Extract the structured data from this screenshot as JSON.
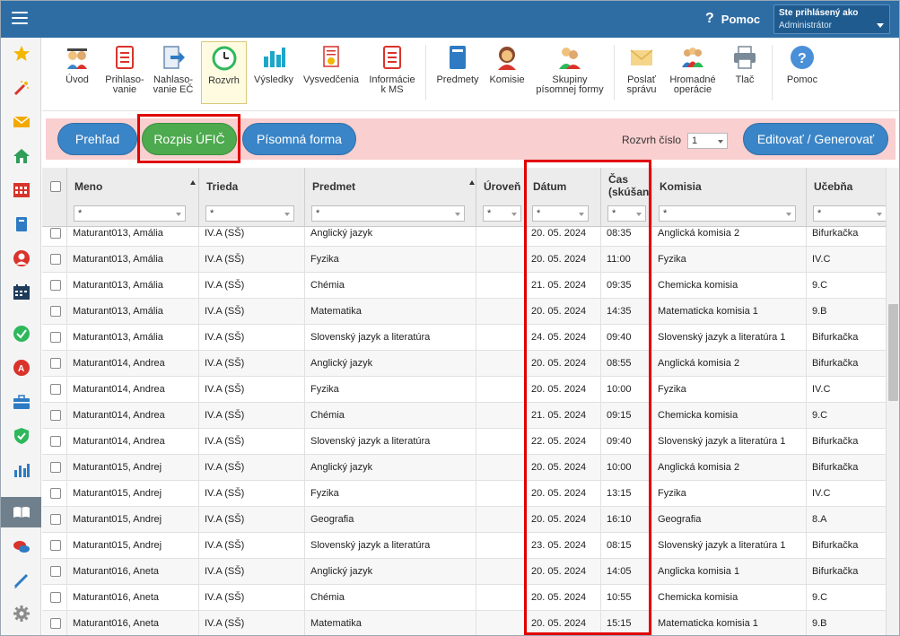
{
  "topbar": {
    "help_label": "Pomoc",
    "user_label": "Ste prihlásený ako",
    "user_role": "Administrátor"
  },
  "sidebar": {
    "icons": [
      "star-icon",
      "magic-wand-icon",
      "mail-icon",
      "home-icon",
      "calendar-grid-icon",
      "book-icon",
      "person-icon",
      "schedule-icon",
      "check-circle-icon",
      "grade-a-icon",
      "briefcase-icon",
      "shield-check-icon",
      "bar-chart-icon",
      "open-book-icon",
      "chat-icon",
      "pen-icon",
      "gear-icon"
    ]
  },
  "toolbar": {
    "items": [
      {
        "label": "Úvod",
        "icon": "students-icon"
      },
      {
        "label": "Prihlaso-\nvanie",
        "icon": "document-list-icon"
      },
      {
        "label": "Nahlaso-\nvanie EČ",
        "icon": "arrow-doc-icon"
      },
      {
        "label": "Rozvrh",
        "icon": "clock-icon"
      },
      {
        "label": "Výsledky",
        "icon": "bar-chart-icon"
      },
      {
        "label": "Vysvedčenia",
        "icon": "certificate-icon"
      },
      {
        "label": "Informácie\nk MS",
        "icon": "info-doc-icon"
      },
      {
        "label": "Predmety",
        "icon": "book-icon"
      },
      {
        "label": "Komisie",
        "icon": "woman-icon"
      },
      {
        "label": "Skupiny\npísomnej formy",
        "icon": "group-icon"
      },
      {
        "label": "Poslať\nsprávu",
        "icon": "envelope-icon"
      },
      {
        "label": "Hromadné\noperácie",
        "icon": "people-icon"
      },
      {
        "label": "Tlač",
        "icon": "printer-icon"
      },
      {
        "label": "Pomoc",
        "icon": "help-icon"
      }
    ]
  },
  "actions": {
    "prehlad": "Prehľad",
    "rozpis": "Rozpis ÚFIČ",
    "pisomna": "Písomná forma",
    "rozvrh_label": "Rozvrh číslo",
    "rozvrh_value": "1",
    "edit": "Editovať / Generovať"
  },
  "table": {
    "columns": [
      "Meno",
      "Trieda",
      "Predmet",
      "Úroveň",
      "Dátum",
      "Čas\n(skúšan",
      "Komisia",
      "Učebňa"
    ],
    "filter_value": "*",
    "rows": [
      [
        "Maturant013, Amália",
        "IV.A (SŠ)",
        "Anglický jazyk",
        "",
        "20. 05. 2024",
        "08:35",
        "Anglická komisia 2",
        "Bifurkačka"
      ],
      [
        "Maturant013, Amália",
        "IV.A (SŠ)",
        "Fyzika",
        "",
        "20. 05. 2024",
        "11:00",
        "Fyzika",
        "IV.C"
      ],
      [
        "Maturant013, Amália",
        "IV.A (SŠ)",
        "Chémia",
        "",
        "21. 05. 2024",
        "09:35",
        "Chemicka komisia",
        "9.C"
      ],
      [
        "Maturant013, Amália",
        "IV.A (SŠ)",
        "Matematika",
        "",
        "20. 05. 2024",
        "14:35",
        "Matematicka komisia 1",
        "9.B"
      ],
      [
        "Maturant013, Amália",
        "IV.A (SŠ)",
        "Slovenský jazyk a literatúra",
        "",
        "24. 05. 2024",
        "09:40",
        "Slovenský jazyk a literatúra 1",
        "Bifurkačka"
      ],
      [
        "Maturant014, Andrea",
        "IV.A (SŠ)",
        "Anglický jazyk",
        "",
        "20. 05. 2024",
        "08:55",
        "Anglická komisia 2",
        "Bifurkačka"
      ],
      [
        "Maturant014, Andrea",
        "IV.A (SŠ)",
        "Fyzika",
        "",
        "20. 05. 2024",
        "10:00",
        "Fyzika",
        "IV.C"
      ],
      [
        "Maturant014, Andrea",
        "IV.A (SŠ)",
        "Chémia",
        "",
        "21. 05. 2024",
        "09:15",
        "Chemicka komisia",
        "9.C"
      ],
      [
        "Maturant014, Andrea",
        "IV.A (SŠ)",
        "Slovenský jazyk a literatúra",
        "",
        "22. 05. 2024",
        "09:40",
        "Slovenský jazyk a literatúra 1",
        "Bifurkačka"
      ],
      [
        "Maturant015, Andrej",
        "IV.A (SŠ)",
        "Anglický jazyk",
        "",
        "20. 05. 2024",
        "10:00",
        "Anglická komisia 2",
        "Bifurkačka"
      ],
      [
        "Maturant015, Andrej",
        "IV.A (SŠ)",
        "Fyzika",
        "",
        "20. 05. 2024",
        "13:15",
        "Fyzika",
        "IV.C"
      ],
      [
        "Maturant015, Andrej",
        "IV.A (SŠ)",
        "Geografia",
        "",
        "20. 05. 2024",
        "16:10",
        "Geografia",
        "8.A"
      ],
      [
        "Maturant015, Andrej",
        "IV.A (SŠ)",
        "Slovenský jazyk a literatúra",
        "",
        "23. 05. 2024",
        "08:15",
        "Slovenský jazyk a literatúra 1",
        "Bifurkačka"
      ],
      [
        "Maturant016, Aneta",
        "IV.A (SŠ)",
        "Anglický jazyk",
        "",
        "20. 05. 2024",
        "14:05",
        "Anglicka komisia 1",
        "Bifurkačka"
      ],
      [
        "Maturant016, Aneta",
        "IV.A (SŠ)",
        "Chémia",
        "",
        "20. 05. 2024",
        "10:55",
        "Chemicka komisia",
        "9.C"
      ],
      [
        "Maturant016, Aneta",
        "IV.A (SŠ)",
        "Matematika",
        "",
        "20. 05. 2024",
        "15:15",
        "Matematicka komisia 1",
        "9.B"
      ]
    ]
  },
  "colors": {
    "topbar": "#2e6da4",
    "strip": "#f9cfd0",
    "pill_blue": "#3a85c7",
    "pill_green": "#4daa4e",
    "highlight": "#e00000"
  }
}
